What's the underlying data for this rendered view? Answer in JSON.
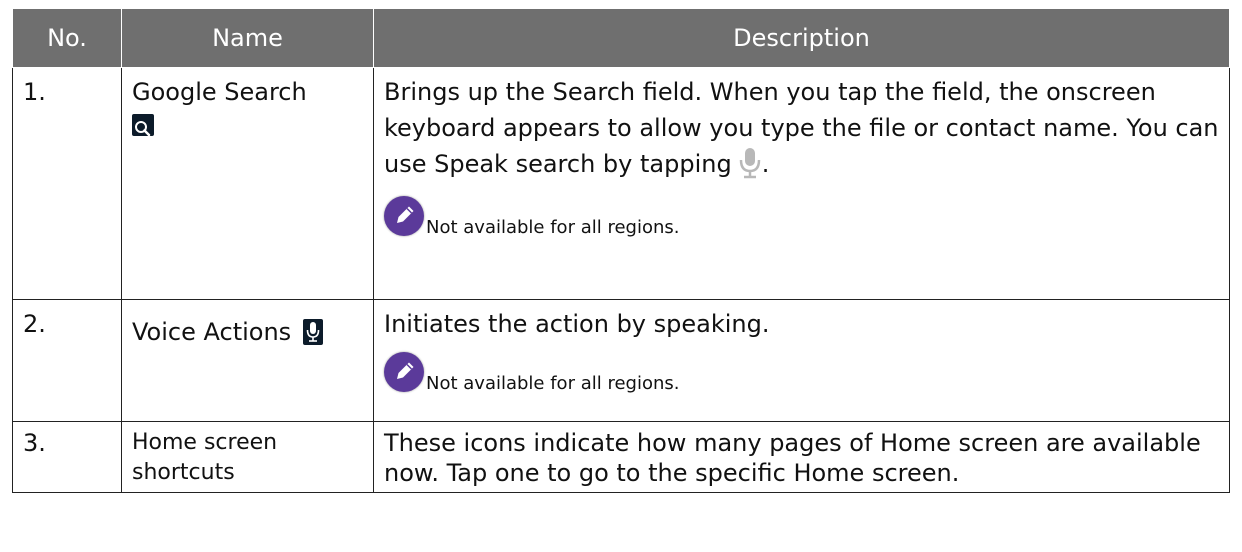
{
  "headers": {
    "no": "No.",
    "name": "Name",
    "description": "Description"
  },
  "rows": [
    {
      "no": "1.",
      "name": "Google Search",
      "name_icon": "search-icon",
      "description_before": "Brings up the Search field. When you tap the field, the onscreen keyboard appears to allow you type the file or contact name. You can use Speak search by tapping",
      "description_after": ".",
      "inline_icon": "microphone-icon",
      "note_icon": "pencil-note-icon",
      "note": "Not available for all regions."
    },
    {
      "no": "2.",
      "name": "Voice Actions",
      "name_icon": "microphone-icon",
      "description": "Initiates the action by speaking.",
      "note_icon": "pencil-note-icon",
      "note": "Not available for all regions."
    },
    {
      "no": "3.",
      "name": "Home screen shortcuts",
      "description": "These icons indicate how many pages of Home screen are available now. Tap one to go to the specific Home screen."
    }
  ],
  "colors": {
    "header_bg": "#6f6f6f",
    "header_text": "#ffffff",
    "note_icon": "#5b3a9a",
    "search_icon_bg": "#0c1b2a"
  }
}
